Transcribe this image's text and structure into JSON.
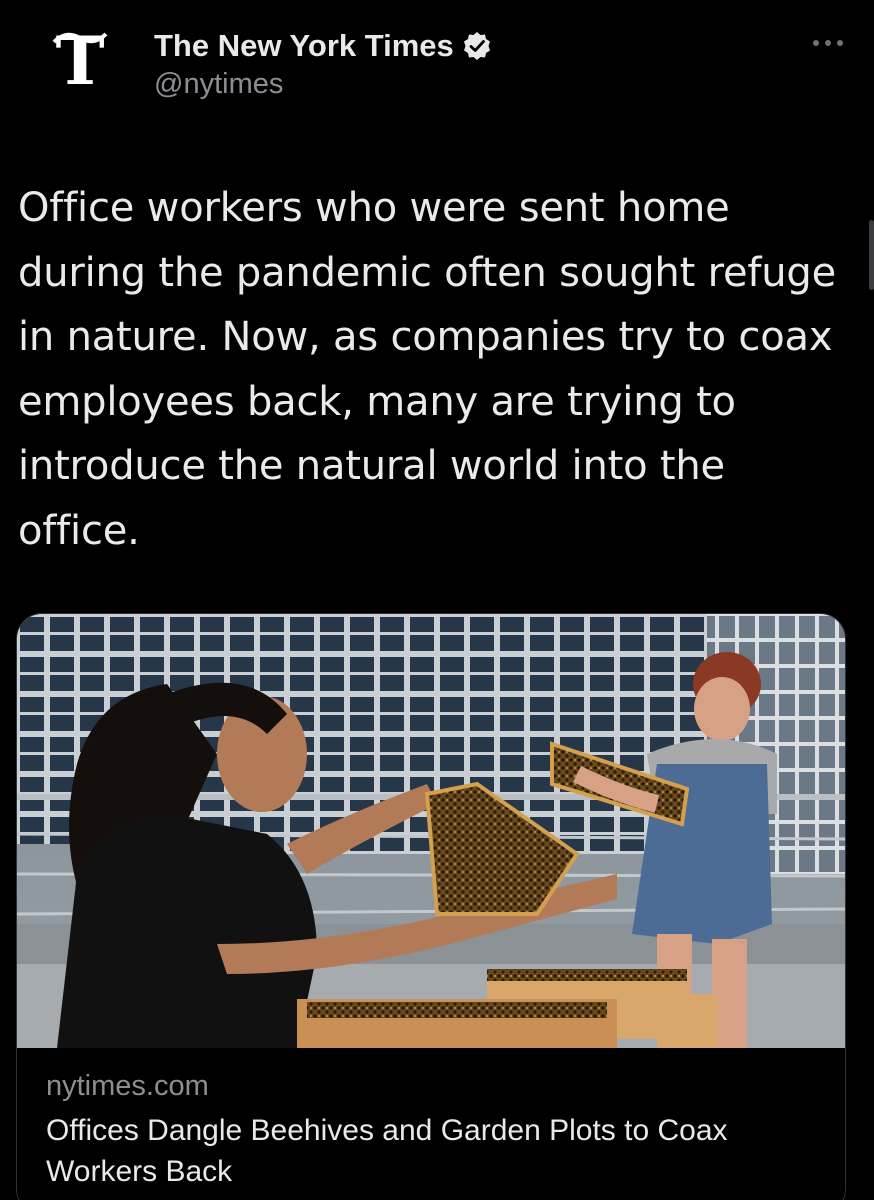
{
  "tweet": {
    "author": {
      "display_name": "The New York Times",
      "handle": "@nytimes",
      "verified": true,
      "avatar_icon": "nyt-t-logo-icon",
      "avatar_letter": "T"
    },
    "menu_icon": "more-horizontal-icon",
    "text": "Office workers who were sent home during the pandemic often sought refuge in nature. Now, as companies try to coax employees back, many are trying to introduce the natural world into the office.",
    "card": {
      "image_icon": "article-photo-beekeepers-rooftop",
      "domain": "nytimes.com",
      "title": "Offices Dangle Beehives and Garden Plots to Coax Workers Back"
    }
  },
  "colors": {
    "background": "#000000",
    "primary_text": "#e7e9ea",
    "secondary_text": "#8b8f93",
    "border": "#2f3336"
  }
}
